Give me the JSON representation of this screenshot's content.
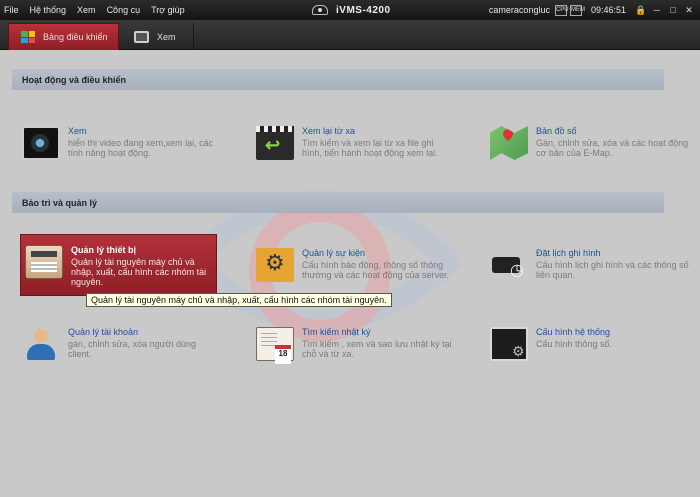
{
  "menu": [
    "File",
    "Hệ thống",
    "Xem",
    "Công cụ",
    "Trợ giúp"
  ],
  "app_title": "iVMS-4200",
  "user": "cameracongluc",
  "status_icons": [
    "CPU",
    "MEM"
  ],
  "clock": "09:46:51",
  "window_controls": {
    "lock": "🔒",
    "minimize": "─",
    "maximize": "□",
    "close": "✕"
  },
  "tabs": [
    {
      "label": "Bảng điều khiển",
      "icon": "dashboard-grid-icon",
      "active": true
    },
    {
      "label": "Xem",
      "icon": "monitor-icon",
      "active": false
    }
  ],
  "sections": [
    {
      "title": "Hoạt động và điều khiển",
      "items": [
        {
          "title": "Xem",
          "desc": "hiển thị video đang xem,xem lại, các tính năng hoạt động.",
          "icon": "live-view-icon"
        },
        {
          "title": "Xem lại từ xa",
          "desc": "Tìm kiếm và xem lại từ xa file ghi hình, tiến hành hoạt động xem lại.",
          "icon": "playback-icon"
        },
        {
          "title": "Bản đồ số",
          "desc": "Gán, chỉnh sửa, xóa và các hoạt động cơ bản của E-Map.",
          "icon": "emap-icon"
        }
      ]
    },
    {
      "title": "Bảo trì và quản lý",
      "items": [
        {
          "title": "Quản lý thiết bị",
          "desc": "Quản lý tài nguyên máy chủ và nhập, xuất, cấu hình các nhóm tài nguyên.",
          "icon": "device-management-icon",
          "selected": true
        },
        {
          "title": "Quản lý sự kiện",
          "desc": "Cấu hình báo động, thông số thông thường và các hoạt động của server.",
          "icon": "event-management-icon"
        },
        {
          "title": "Đặt lịch ghi hình",
          "desc": "Cấu hình lịch ghi hình và các thông số liên quan.",
          "icon": "record-schedule-icon"
        },
        {
          "title": "Quản lý tài khoản",
          "desc": "gán, chỉnh sửa, xóa người dùng client.",
          "icon": "account-management-icon"
        },
        {
          "title": "Tìm kiếm nhật ký",
          "desc": "Tìm kiếm , xem và sao lưu nhật ký tại chỗ và từ xa.",
          "icon": "log-search-icon"
        },
        {
          "title": "Cấu hình hệ thống",
          "desc": "Cấu hình thông số.",
          "icon": "system-config-icon"
        }
      ]
    }
  ],
  "tooltip": "Quản lý tài nguyên máy chủ và nhập, xuất, cấu hình các nhóm tài nguyên.",
  "colors": {
    "accent_red": "#a8262f",
    "title_blue": "#1f4f9a",
    "header_bar": "#1c1c1c"
  }
}
